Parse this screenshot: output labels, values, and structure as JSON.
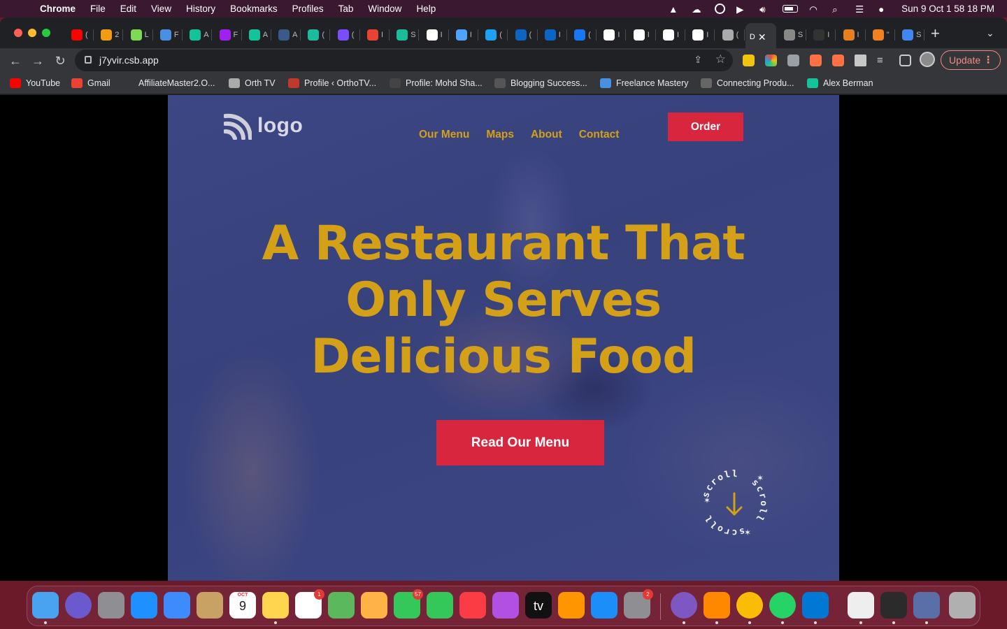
{
  "menubar": {
    "app": "Chrome",
    "items": [
      "File",
      "Edit",
      "View",
      "History",
      "Bookmarks",
      "Profiles",
      "Tab",
      "Window",
      "Help"
    ],
    "clock": "Sun 9 Oct  1 58 18 PM"
  },
  "browser": {
    "tabs": [
      {
        "icon": "youtube-icon",
        "color": "#ff0000",
        "title": "("
      },
      {
        "icon": "orange-circle-icon",
        "color": "#f39c12",
        "title": "2"
      },
      {
        "icon": "bracket-icon",
        "color": "#7ed957",
        "title": "L"
      },
      {
        "icon": "a-letter-icon",
        "color": "#4a90e2",
        "title": "F"
      },
      {
        "icon": "grammarly-icon",
        "color": "#15c39a",
        "title": "A"
      },
      {
        "icon": "u-icon",
        "color": "#a020f0",
        "title": "F"
      },
      {
        "icon": "grammarly-icon",
        "color": "#15c39a",
        "title": "A"
      },
      {
        "icon": "wordpress-icon",
        "color": "#3a5a8a",
        "title": "A"
      },
      {
        "icon": "swirl-icon",
        "color": "#1abc9c",
        "title": "("
      },
      {
        "icon": "hashnode-icon",
        "color": "#7a4dff",
        "title": "("
      },
      {
        "icon": "gmail-icon",
        "color": "#ea4335",
        "title": "I"
      },
      {
        "icon": "diamond-icon",
        "color": "#1abc9c",
        "title": "S"
      },
      {
        "icon": "github-icon",
        "color": "#ffffff",
        "title": "I"
      },
      {
        "icon": "code-icon",
        "color": "#4fa3ff",
        "title": "I"
      },
      {
        "icon": "twitter-icon",
        "color": "#1da1f2",
        "title": "("
      },
      {
        "icon": "linkedin-icon",
        "color": "#0a66c2",
        "title": "("
      },
      {
        "icon": "linkedin-icon",
        "color": "#0a66c2",
        "title": "I"
      },
      {
        "icon": "facebook-icon",
        "color": "#1877f2",
        "title": "("
      },
      {
        "icon": "square-icon",
        "color": "#ffffff",
        "title": "I"
      },
      {
        "icon": "square-icon",
        "color": "#ffffff",
        "title": "I"
      },
      {
        "icon": "square-icon",
        "color": "#ffffff",
        "title": "I"
      },
      {
        "icon": "square-icon",
        "color": "#ffffff",
        "title": "I"
      },
      {
        "icon": "globe-icon",
        "color": "#aaaaaa",
        "title": "("
      },
      {
        "icon": "active-tab-icon",
        "color": "#35363a",
        "title": "D"
      },
      {
        "icon": "loading-icon",
        "color": "#888888",
        "title": "S"
      },
      {
        "icon": "dark-square-icon",
        "color": "#333333",
        "title": "I"
      },
      {
        "icon": "pen-icon",
        "color": "#e67e22",
        "title": "I"
      },
      {
        "icon": "stack-icon",
        "color": "#f48024",
        "title": "\""
      },
      {
        "icon": "google-icon",
        "color": "#4285f4",
        "title": "S"
      }
    ],
    "url": "j7yvir.csb.app",
    "update_label": "Update",
    "bookmarks": [
      {
        "icon": "youtube-icon",
        "color": "#ff0000",
        "label": "YouTube"
      },
      {
        "icon": "gmail-icon",
        "color": "#ea4335",
        "label": "Gmail"
      },
      {
        "icon": "blank-icon",
        "color": "#35363a",
        "label": "AffiliateMaster2.O..."
      },
      {
        "icon": "globe-icon",
        "color": "#aaaaaa",
        "label": "Orth TV"
      },
      {
        "icon": "profile-icon",
        "color": "#c0392b",
        "label": "Profile ‹ OrthoTV..."
      },
      {
        "icon": "wv-icon",
        "color": "#444444",
        "label": "Profile: Mohd Sha..."
      },
      {
        "icon": "blog-icon",
        "color": "#555555",
        "label": "Blogging Success..."
      },
      {
        "icon": "a-letter-icon",
        "color": "#4a90e2",
        "label": "Freelance Mastery"
      },
      {
        "icon": "product-icon",
        "color": "#666666",
        "label": "Connecting Produ..."
      },
      {
        "icon": "grammarly-icon",
        "color": "#15c39a",
        "label": "Alex Berman"
      }
    ]
  },
  "site": {
    "logo_text": "logo",
    "nav": [
      "Our Menu",
      "Maps",
      "About",
      "Contact"
    ],
    "order_label": "Order",
    "hero_line1": "A Restaurant That",
    "hero_line2": "Only Serves",
    "hero_line3": "Delicious Food",
    "cta_label": "Read Our Menu",
    "scroll_text": "scroll",
    "accent": "#d4a017",
    "button_color": "#d7263d"
  },
  "dock": {
    "apps": [
      {
        "name": "finder-icon",
        "color": "#4aa3f0"
      },
      {
        "name": "siri-icon",
        "color": "#6a5acd"
      },
      {
        "name": "launchpad-icon",
        "color": "#8e8e93"
      },
      {
        "name": "safari-icon",
        "color": "#1e90ff"
      },
      {
        "name": "mail-icon",
        "color": "#3d8bfd"
      },
      {
        "name": "contacts-icon",
        "color": "#c8a165"
      },
      {
        "name": "calendar-icon",
        "color": "#ffffff",
        "label": "9",
        "month": "OCT"
      },
      {
        "name": "notes-icon",
        "color": "#ffd54f"
      },
      {
        "name": "reminders-icon",
        "color": "#ffffff",
        "badge": "1"
      },
      {
        "name": "maps-icon",
        "color": "#5cb85c"
      },
      {
        "name": "photos-icon",
        "color": "#ffb347"
      },
      {
        "name": "messages-icon",
        "color": "#34c759",
        "badge": "57"
      },
      {
        "name": "facetime-icon",
        "color": "#34c759"
      },
      {
        "name": "music-icon",
        "color": "#fc3c44"
      },
      {
        "name": "podcasts-icon",
        "color": "#b150e2"
      },
      {
        "name": "appletv-icon",
        "color": "#111111",
        "label": "tv"
      },
      {
        "name": "books-icon",
        "color": "#ff9500"
      },
      {
        "name": "appstore-icon",
        "color": "#1c8ef9"
      },
      {
        "name": "settings-icon",
        "color": "#8e8e93",
        "badge": "2"
      },
      {
        "name": "tor-icon",
        "color": "#7e57c2"
      },
      {
        "name": "vlc-icon",
        "color": "#ff8800"
      },
      {
        "name": "chrome-icon",
        "color": "#fbbc05"
      },
      {
        "name": "whatsapp-icon",
        "color": "#25d366"
      },
      {
        "name": "vscode-icon",
        "color": "#0078d4"
      },
      {
        "name": "document-thumb-icon",
        "color": "#eeeeee"
      },
      {
        "name": "terminal-thumb-icon",
        "color": "#2b2b2b"
      },
      {
        "name": "window-thumb-icon",
        "color": "#5a6fa8"
      },
      {
        "name": "trash-icon",
        "color": "#b0b0b0"
      }
    ]
  }
}
